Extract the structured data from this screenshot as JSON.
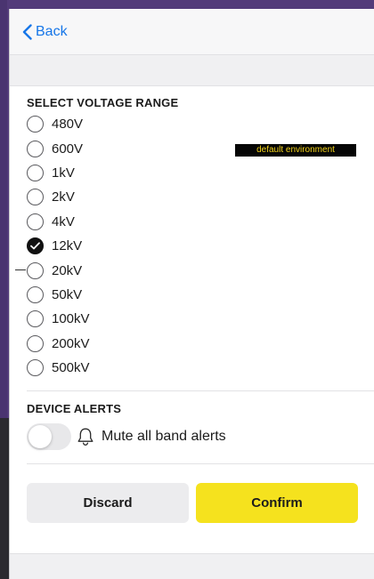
{
  "nav": {
    "back_label": "Back"
  },
  "voltage": {
    "section_title": "SELECT VOLTAGE RANGE",
    "selected": "12kV",
    "options": [
      {
        "label": "480V",
        "checked": false
      },
      {
        "label": "600V",
        "checked": false
      },
      {
        "label": "1kV",
        "checked": false
      },
      {
        "label": "2kV",
        "checked": false
      },
      {
        "label": "4kV",
        "checked": false
      },
      {
        "label": "12kV",
        "checked": true
      },
      {
        "label": "20kV",
        "checked": false
      },
      {
        "label": "50kV",
        "checked": false
      },
      {
        "label": "100kV",
        "checked": false
      },
      {
        "label": "200kV",
        "checked": false
      },
      {
        "label": "500kV",
        "checked": false
      }
    ]
  },
  "badge": {
    "text": "default environment",
    "background": "#050505",
    "color": "#f2d21b"
  },
  "alerts": {
    "section_title": "DEVICE ALERTS",
    "mute_label": "Mute all band alerts",
    "mute_enabled": false,
    "icon": "bell-icon"
  },
  "actions": {
    "discard_label": "Discard",
    "confirm_label": "Confirm",
    "confirm_color": "#f5e21e"
  },
  "colors": {
    "accent": "#1676e8",
    "frame": "#533b7a"
  }
}
